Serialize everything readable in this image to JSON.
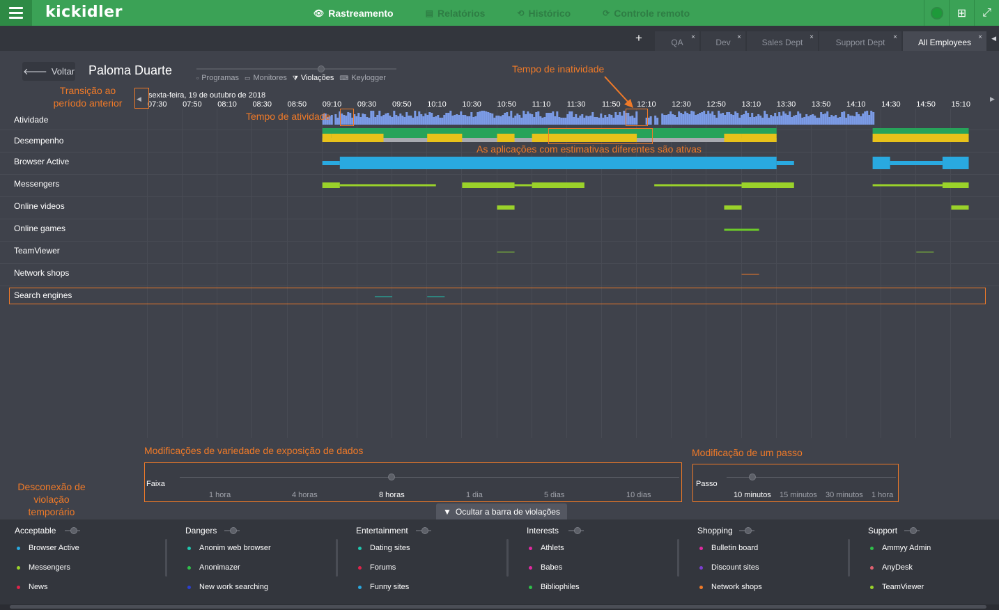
{
  "header": {
    "logo": "kickidler",
    "nav": [
      {
        "label": "Rastreamento",
        "icon": "eye-icon",
        "active": true
      },
      {
        "label": "Relatórios",
        "icon": "report-icon",
        "active": false
      },
      {
        "label": "Histórico",
        "icon": "history-icon",
        "active": false
      },
      {
        "label": "Controle remoto",
        "icon": "remote-icon",
        "active": false
      }
    ]
  },
  "tabs": {
    "add": "+",
    "items": [
      {
        "label": "QA"
      },
      {
        "label": "Dev"
      },
      {
        "label": "Sales Dept"
      },
      {
        "label": "Support Dept"
      },
      {
        "label": "All Employees",
        "active": true
      }
    ],
    "close": "×"
  },
  "subheader": {
    "back_label": "Voltar",
    "employee_name": "Paloma Duarte",
    "views": [
      {
        "label": "Programas",
        "active": false
      },
      {
        "label": "Monitores",
        "active": false
      },
      {
        "label": "Violações",
        "active": true
      },
      {
        "label": "Keylogger",
        "active": false
      }
    ]
  },
  "timeline": {
    "date": "sexta-feira, 19 de outubro de 2018",
    "ticks": [
      "07:30",
      "07:50",
      "08:10",
      "08:30",
      "08:50",
      "09:10",
      "09:30",
      "09:50",
      "10:10",
      "10:30",
      "10:50",
      "11:10",
      "11:30",
      "11:50",
      "12:10",
      "12:30",
      "12:50",
      "13:10",
      "13:30",
      "13:50",
      "14:10",
      "14:30",
      "14:50",
      "15:10"
    ],
    "rows": [
      "Atividade",
      "Desempenho",
      "Browser Active",
      "Messengers",
      "Online videos",
      "Online games",
      "TeamViewer",
      "Network shops",
      "Search engines"
    ]
  },
  "annotations": {
    "prev_period": "Transição ao período anterior",
    "activity_time": "Tempo de atividade",
    "inactivity_time": "Tempo de inatividade",
    "apps_estimates": "As aplicações com estimativas diferentes são ativas",
    "range_mod": "Modificações de variedade de exposição de dados",
    "step_mod": "Modificação de um passo",
    "violation_disconnect": "Desconexão de violação temporário"
  },
  "range": {
    "title": "Faixa",
    "options": [
      "1 hora",
      "4 horas",
      "8 horas",
      "1 dia",
      "5 dias",
      "10 dias"
    ],
    "selected": "8 horas"
  },
  "step": {
    "title": "Passo",
    "options": [
      "10 minutos",
      "15 minutos",
      "30 minutos",
      "1 hora"
    ],
    "selected": "10 minutos"
  },
  "hide_violations_label": "Ocultar a barra de violações",
  "violation_categories": [
    {
      "title": "Acceptable",
      "items": [
        {
          "label": "Browser Active",
          "color": "#29a9e0"
        },
        {
          "label": "Messengers",
          "color": "#9ad22a"
        },
        {
          "label": "News",
          "color": "#e0234a"
        }
      ]
    },
    {
      "title": "Dangers",
      "items": [
        {
          "label": "Anonim web browser",
          "color": "#1fc7b0"
        },
        {
          "label": "Anonimazer",
          "color": "#2fbf4a"
        },
        {
          "label": "New work searching",
          "color": "#2b3fd1"
        }
      ]
    },
    {
      "title": "Entertainment",
      "items": [
        {
          "label": "Dating sites",
          "color": "#1fc7b0"
        },
        {
          "label": "Forums",
          "color": "#e0234a"
        },
        {
          "label": "Funny sites",
          "color": "#29a9e0"
        }
      ]
    },
    {
      "title": "Interests",
      "items": [
        {
          "label": "Athlets",
          "color": "#e02aa0"
        },
        {
          "label": "Babes",
          "color": "#e02aa0"
        },
        {
          "label": "Bibliophiles",
          "color": "#2fbf4a"
        }
      ]
    },
    {
      "title": "Shopping",
      "items": [
        {
          "label": "Bulletin board",
          "color": "#e02aa0"
        },
        {
          "label": "Discount sites",
          "color": "#7b3fd1"
        },
        {
          "label": "Network shops",
          "color": "#f07a28"
        }
      ]
    },
    {
      "title": "Support",
      "items": [
        {
          "label": "Ammyy Admin",
          "color": "#2fbf4a"
        },
        {
          "label": "AnyDesk",
          "color": "#e06070"
        },
        {
          "label": "TeamViewer",
          "color": "#9ad22a"
        }
      ]
    }
  ],
  "colors": {
    "accent_green": "#3ba256",
    "annotation": "#f07a28",
    "activity": "#7b9be6",
    "perf_green": "#27a35a",
    "perf_yellow": "#e8c21a",
    "perf_gray": "#a8aab0",
    "browser": "#29a9e0",
    "messengers": "#9ad22a",
    "online_videos": "#9ad22a",
    "online_games": "#6cc92a",
    "teamviewer": "#7fbf3a",
    "network_shops": "#f07a28",
    "search_engines": "#1fc7b0"
  },
  "chart_data": {
    "type": "timeline",
    "x_unit": "time",
    "activity": [
      [
        "09:10",
        "09:15"
      ],
      [
        "09:17",
        "12:10"
      ],
      [
        "12:15",
        "12:18"
      ],
      [
        "12:20",
        "12:22"
      ],
      [
        "12:24",
        "14:25"
      ]
    ],
    "performance_bands": [
      {
        "start": "09:10",
        "end": "09:15",
        "color": "yellow"
      },
      {
        "start": "09:15",
        "end": "09:45",
        "color": "yellow"
      },
      {
        "start": "10:10",
        "end": "10:30",
        "color": "yellow"
      },
      {
        "start": "10:50",
        "end": "11:00",
        "color": "yellow"
      },
      {
        "start": "11:10",
        "end": "12:10",
        "color": "yellow"
      },
      {
        "start": "13:00",
        "end": "13:10",
        "color": "yellow"
      },
      {
        "start": "13:10",
        "end": "13:30",
        "color": "yellow"
      },
      {
        "start": "14:25",
        "end": "15:20",
        "color": "yellow"
      }
    ],
    "series": [
      {
        "name": "Browser Active",
        "segments": [
          [
            "09:10",
            "09:20"
          ],
          [
            "09:20",
            "13:30"
          ],
          [
            "13:30",
            "13:40"
          ],
          [
            "14:25",
            "14:35"
          ],
          [
            "14:35",
            "15:05"
          ],
          [
            "15:05",
            "15:20"
          ]
        ]
      },
      {
        "name": "Messengers",
        "segments": [
          [
            "09:10",
            "09:20"
          ],
          [
            "09:20",
            "10:15"
          ],
          [
            "10:30",
            "11:00"
          ],
          [
            "11:00",
            "11:10"
          ],
          [
            "11:10",
            "11:40"
          ],
          [
            "12:20",
            "13:10"
          ],
          [
            "13:10",
            "13:40"
          ],
          [
            "14:25",
            "15:05"
          ],
          [
            "15:05",
            "15:20"
          ]
        ]
      },
      {
        "name": "Online videos",
        "segments": [
          [
            "10:50",
            "11:00"
          ],
          [
            "13:00",
            "13:10"
          ],
          [
            "15:10",
            "15:20"
          ]
        ]
      },
      {
        "name": "Online games",
        "segments": [
          [
            "13:00",
            "13:20"
          ]
        ]
      },
      {
        "name": "TeamViewer",
        "segments": [
          [
            "10:50",
            "11:00"
          ],
          [
            "14:50",
            "15:00"
          ]
        ]
      },
      {
        "name": "Network shops",
        "segments": [
          [
            "13:10",
            "13:20"
          ]
        ]
      },
      {
        "name": "Search engines",
        "segments": [
          [
            "09:40",
            "09:50"
          ],
          [
            "10:10",
            "10:20"
          ]
        ]
      }
    ]
  }
}
